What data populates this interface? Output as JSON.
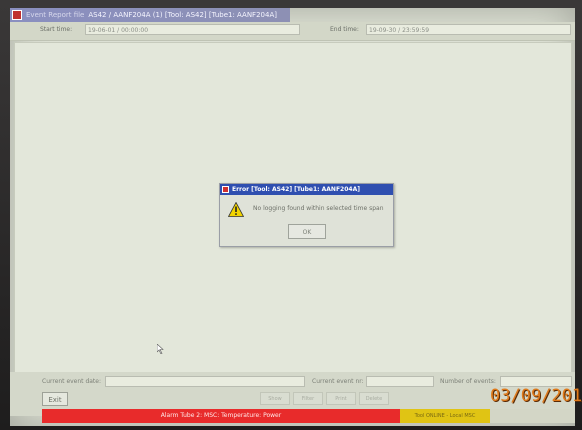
{
  "window": {
    "title_prefix": "Event Report file",
    "title": "AS42 / AANF204A (1) [Tool: AS42] [Tube1: AANF204A]"
  },
  "time_range": {
    "start_label": "Start time:",
    "start_value": "19-06-01 / 00:00:00",
    "end_label": "End time:",
    "end_value": "19-09-30 / 23:59:59"
  },
  "dialog": {
    "title": "Error [Tool: AS42] [Tube1: AANF204A]",
    "message": "No logging found within selected time span",
    "ok_label": "OK"
  },
  "bottom": {
    "current_event_date_label": "Current event date:",
    "current_event_nr_label": "Current event nr:",
    "number_of_events_label": "Number of events:",
    "exit_label": "Exit",
    "disabled_buttons": [
      "Show",
      "Filter",
      "Print",
      "Delete"
    ]
  },
  "status": {
    "alarm_text": "Alarm Tube 2: MSC: Temperature: Power",
    "online_text": "Tool ONLINE - Local MSC"
  },
  "photo": {
    "date_stamp": "03/09/201"
  },
  "colors": {
    "alarm": "#e82b2b",
    "online": "#e0c414",
    "dialog_title_bg": "#2f4fb0",
    "date_stamp": "#e07a1a"
  }
}
